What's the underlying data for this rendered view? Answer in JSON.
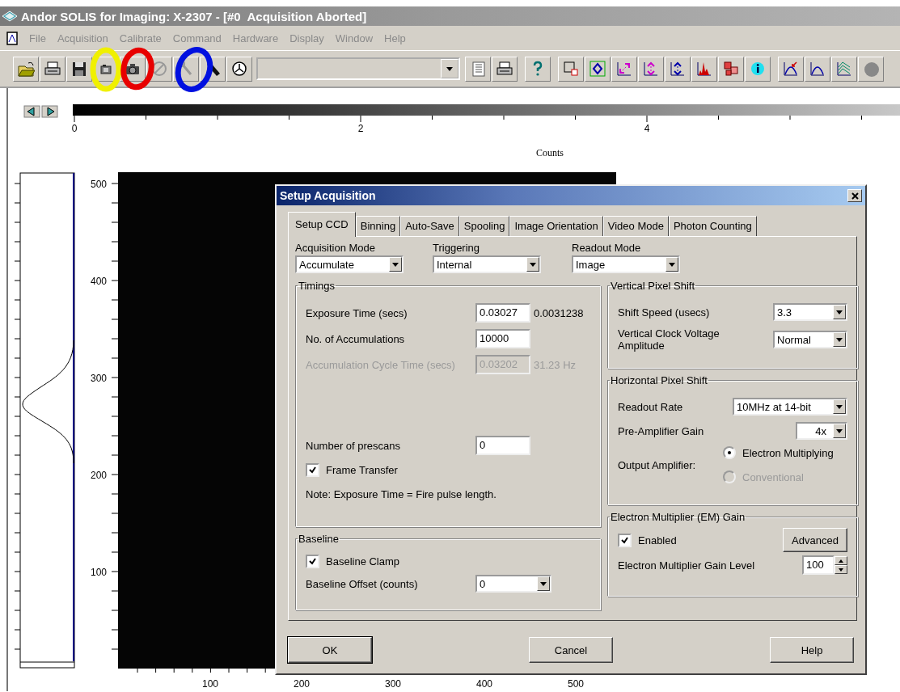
{
  "window": {
    "title": "Andor SOLIS for Imaging: X-2307 - [#0  Acquisition Aborted]"
  },
  "menu": [
    "File",
    "Acquisition",
    "Calibrate",
    "Command",
    "Hardware",
    "Display",
    "Window",
    "Help"
  ],
  "annotations": [
    {
      "color": "#f0f000"
    },
    {
      "color": "#e80000"
    },
    {
      "color": "#0010e0"
    }
  ],
  "colorbar": {
    "tick_labels": [
      "0",
      "2",
      "4"
    ],
    "label": "Counts"
  },
  "plot": {
    "y_tick_labels": [
      "500",
      "400",
      "300",
      "200",
      "100"
    ],
    "x_tick_labels": [
      "100",
      "200",
      "300",
      "400",
      "500"
    ]
  },
  "dialog": {
    "title": "Setup Acquisition",
    "tabs": [
      {
        "label": "Setup CCD",
        "selected": true
      },
      {
        "label": "Binning",
        "selected": false
      },
      {
        "label": "Auto-Save",
        "selected": false
      },
      {
        "label": "Spooling",
        "selected": false
      },
      {
        "label": "Image Orientation",
        "selected": false
      },
      {
        "label": "Video Mode",
        "selected": false
      },
      {
        "label": "Photon Counting",
        "selected": false
      }
    ],
    "top_selects": [
      {
        "label": "Acquisition Mode",
        "value": "Accumulate"
      },
      {
        "label": "Triggering",
        "value": "Internal"
      },
      {
        "label": "Readout Mode",
        "value": "Image"
      }
    ],
    "timings": {
      "title": "Timings",
      "rows": [
        {
          "label": "Exposure Time (secs)",
          "value": "0.03027",
          "extra": "0.0031238",
          "disabled": false
        },
        {
          "label": "No. of Accumulations",
          "value": "10000",
          "disabled": false
        },
        {
          "label": "Accumulation Cycle Time (secs)",
          "value": "0.03202",
          "extra": "31.23 Hz",
          "disabled": true
        }
      ],
      "prescans": {
        "label": "Number of prescans",
        "value": "0"
      },
      "frame_transfer": {
        "label": "Frame Transfer",
        "checked": true
      },
      "note": "Note: Exposure Time = Fire pulse length."
    },
    "baseline": {
      "title": "Baseline",
      "clamp": {
        "label": "Baseline Clamp",
        "checked": true
      },
      "offset": {
        "label": "Baseline Offset (counts)",
        "value": "0"
      }
    },
    "vertical_shift": {
      "title": "Vertical Pixel Shift",
      "rows": [
        {
          "label": "Shift Speed (usecs)",
          "value": "3.3"
        },
        {
          "label": "Vertical Clock Voltage Amplitude",
          "value": "Normal"
        }
      ]
    },
    "horizontal_shift": {
      "title": "Horizontal Pixel Shift",
      "rows": [
        {
          "label": "Readout Rate",
          "value": "10MHz at 14-bit"
        },
        {
          "label": "Pre-Amplifier Gain",
          "value": "4x"
        }
      ],
      "output_amplifier": {
        "label": "Output Amplifier:",
        "options": [
          {
            "label": "Electron Multiplying",
            "selected": true,
            "disabled": false
          },
          {
            "label": "Conventional",
            "selected": false,
            "disabled": true
          }
        ]
      }
    },
    "em_gain": {
      "title": "Electron Multiplier (EM) Gain",
      "enabled": {
        "label": "Enabled",
        "checked": true
      },
      "advanced_button": "Advanced",
      "gain_level": {
        "label": "Electron Multiplier Gain Level",
        "value": "100"
      }
    },
    "buttons": [
      "OK",
      "Cancel",
      "Help"
    ]
  }
}
